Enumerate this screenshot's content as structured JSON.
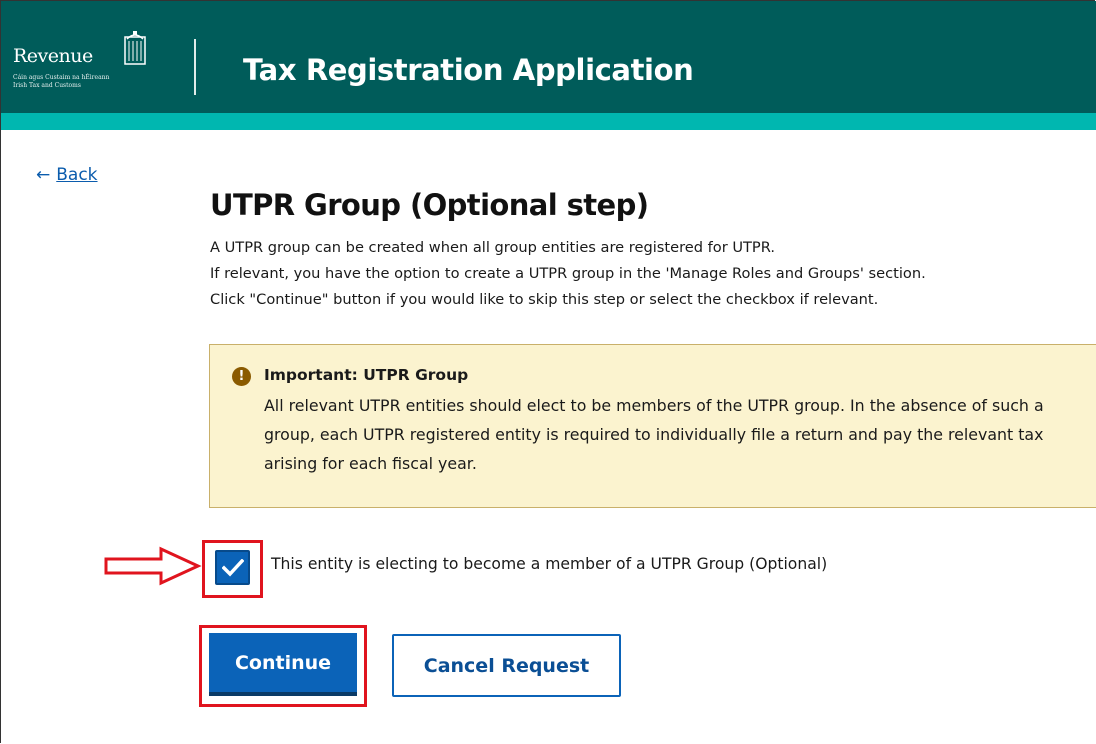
{
  "header": {
    "logo_word": "Revenue",
    "logo_subtitle_1": "Cáin agus Custaim na hÉireann",
    "logo_subtitle_2": "Irish Tax and Customs",
    "app_title": "Tax Registration Application",
    "colors": {
      "header_bg": "#005c5a",
      "stripe": "#00b7b0"
    }
  },
  "nav": {
    "back_arrow": "←",
    "back_label": "Back"
  },
  "page": {
    "title": "UTPR Group (Optional step)",
    "intro": [
      "A UTPR group can be created when all group entities are registered for UTPR.",
      "If relevant, you have the option to create a UTPR group in the 'Manage Roles and Groups' section.",
      "Click \"Continue\" button if you would like to skip this step or select the checkbox if relevant."
    ]
  },
  "notice": {
    "icon": "exclamation-icon",
    "title": "Important: UTPR Group",
    "body": "All relevant UTPR entities should elect to be members of the UTPR group. In the absence of such a group, each UTPR registered entity is required to individually file a return and pay the relevant tax arising for each fiscal year."
  },
  "checkbox": {
    "checked": true,
    "label": "This entity is electing to become a member of a UTPR Group (Optional)"
  },
  "buttons": {
    "continue": "Continue",
    "cancel": "Cancel Request"
  },
  "annotations": {
    "highlight_color": "#e0141e"
  }
}
